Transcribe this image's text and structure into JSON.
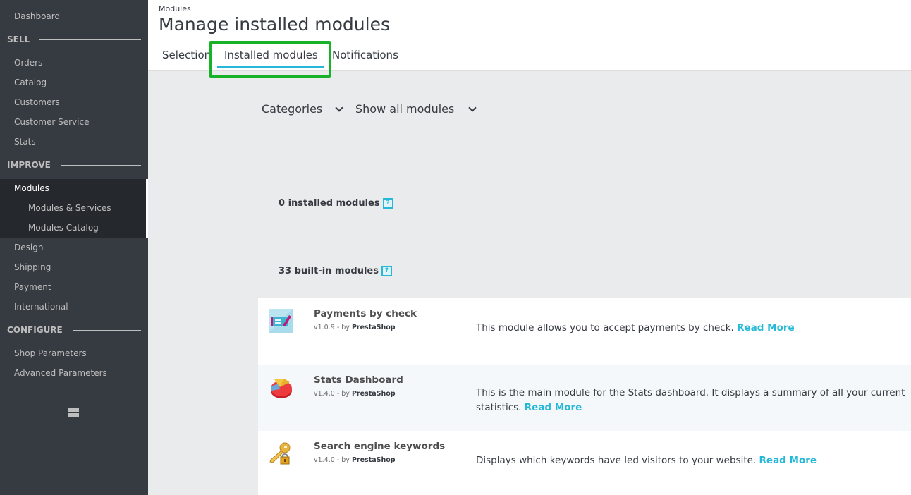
{
  "sidebar": {
    "dashboard": "Dashboard",
    "sections": {
      "sell": "SELL",
      "improve": "IMPROVE",
      "configure": "CONFIGURE"
    },
    "sell_items": [
      "Orders",
      "Catalog",
      "Customers",
      "Customer Service",
      "Stats"
    ],
    "improve_items": {
      "modules": "Modules",
      "modules_services": "Modules & Services",
      "modules_catalog": "Modules Catalog",
      "design": "Design",
      "shipping": "Shipping",
      "payment": "Payment",
      "international": "International"
    },
    "configure_items": [
      "Shop Parameters",
      "Advanced Parameters"
    ],
    "collapse_icon": "hamburger-icon"
  },
  "header": {
    "breadcrumb": "Modules",
    "title": "Manage installed modules",
    "tabs": [
      {
        "label": "Selection",
        "active": false
      },
      {
        "label": "Installed modules",
        "active": true
      },
      {
        "label": "Notifications",
        "active": false
      }
    ]
  },
  "filters": {
    "categories": "Categories",
    "status": "Show all modules"
  },
  "counts": {
    "installed": "0 installed modules",
    "builtin": "33 built-in modules",
    "help_glyph": "?"
  },
  "modules": [
    {
      "name": "Payments by check",
      "version": "v1.0.9 - by",
      "author": "PrestaShop",
      "description": "This module allows you to accept payments by check.",
      "read_more": "Read More",
      "icon": "check-payment-icon"
    },
    {
      "name": "Stats Dashboard",
      "version": "v1.4.0 - by",
      "author": "PrestaShop",
      "description": "This is the main module for the Stats dashboard. It displays a summary of all your current statistics.",
      "read_more": "Read More",
      "icon": "pie-chart-icon"
    },
    {
      "name": "Search engine keywords",
      "version": "v1.4.0 - by",
      "author": "PrestaShop",
      "description": "Displays which keywords have led visitors to your website.",
      "read_more": "Read More",
      "icon": "key-lock-icon"
    }
  ],
  "colors": {
    "accent": "#25b9d7",
    "highlight": "#18b229",
    "sidebar_bg": "#363a41",
    "sidebar_active_bg": "#25292e"
  }
}
